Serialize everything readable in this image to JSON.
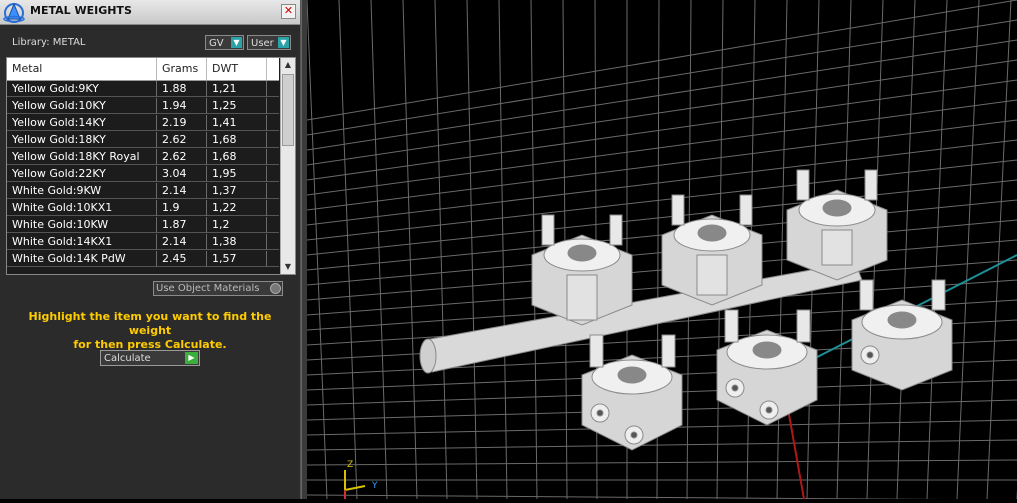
{
  "panel": {
    "title": "METAL WEIGHTS",
    "close_label": "✕",
    "library_label": "Library: METAL",
    "gv_label": "GV",
    "user_label": "User",
    "columns": {
      "metal": "Metal",
      "grams": "Grams",
      "dwt": "DWT"
    },
    "rows": [
      {
        "metal": "Yellow Gold:9KY",
        "grams": "1.88",
        "dwt": "1,21"
      },
      {
        "metal": "Yellow Gold:10KY",
        "grams": "1.94",
        "dwt": "1,25"
      },
      {
        "metal": "Yellow Gold:14KY",
        "grams": "2.19",
        "dwt": "1,41"
      },
      {
        "metal": "Yellow Gold:18KY",
        "grams": "2.62",
        "dwt": "1,68"
      },
      {
        "metal": "Yellow Gold:18KY Royal",
        "grams": "2.62",
        "dwt": "1,68"
      },
      {
        "metal": "Yellow Gold:22KY",
        "grams": "3.04",
        "dwt": "1,95"
      },
      {
        "metal": "White Gold:9KW",
        "grams": "2.14",
        "dwt": "1,37"
      },
      {
        "metal": "White Gold:10KX1",
        "grams": "1.9",
        "dwt": "1,22"
      },
      {
        "metal": "White Gold:10KW",
        "grams": "1.87",
        "dwt": "1,2"
      },
      {
        "metal": "White Gold:14KX1",
        "grams": "2.14",
        "dwt": "1,38"
      },
      {
        "metal": "White Gold:14K PdW",
        "grams": "2.45",
        "dwt": "1,57"
      }
    ],
    "use_object_materials": "Use Object Materials",
    "hint_line1": "Highlight the item you want to find the weight",
    "hint_line2": "for then press Calculate.",
    "calculate_label": "Calculate"
  },
  "viewport": {
    "axis_z": "Z",
    "axis_y": "Y"
  }
}
